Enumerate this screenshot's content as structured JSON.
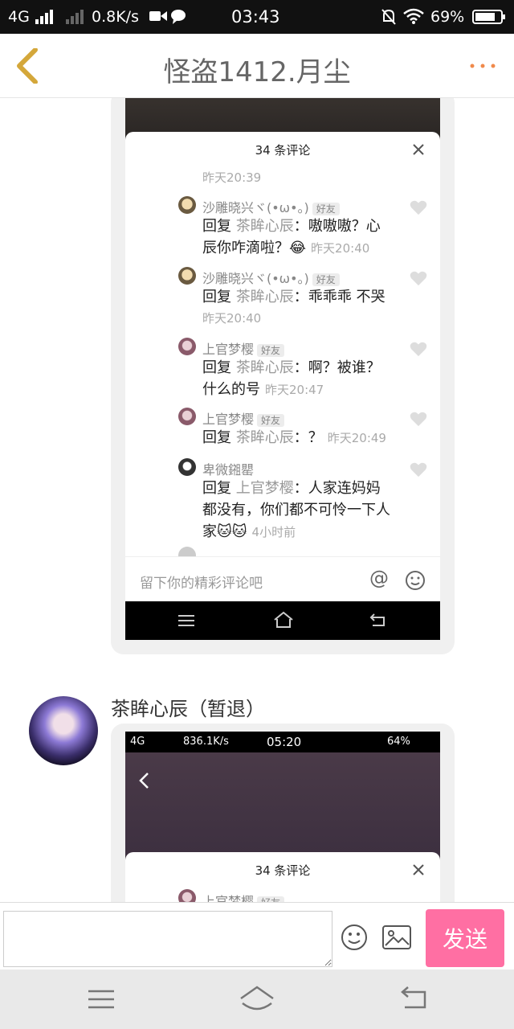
{
  "status_bar": {
    "network": "4G",
    "speed": "0.8K/s",
    "time": "03:43",
    "battery": "69%"
  },
  "header": {
    "back_icon": "chevron-left-icon",
    "title": "怪盗1412.月尘",
    "more_icon": "more-dots-icon"
  },
  "messages": [
    {
      "type": "image",
      "screenshot": {
        "panel_title": "34 条评论",
        "top_time": "昨天20:39",
        "comments": [
          {
            "name": "沙雕晓兴ヾ(•ω•。)",
            "badge": "好友",
            "reply_prefix": "回复",
            "reply_to": "茶眸心辰",
            "text_line1": "：嗷嗷嗷？心",
            "text_line2": "辰你咋滴啦？",
            "emoji": "😂",
            "time": "昨天20:40"
          },
          {
            "name": "沙雕晓兴ヾ(•ω•。)",
            "badge": "好友",
            "reply_prefix": "回复",
            "reply_to": "茶眸心辰",
            "text_line1": "：乖乖乖 不哭",
            "time": "昨天20:40"
          },
          {
            "name": "上官梦樱",
            "badge": "好友",
            "reply_prefix": "回复",
            "reply_to": "茶眸心辰",
            "text_line1": "：啊？被谁？",
            "text_line2": "什么的号",
            "time": "昨天20:47"
          },
          {
            "name": "上官梦樱",
            "badge": "好友",
            "reply_prefix": "回复",
            "reply_to": "茶眸心辰",
            "text_line1": "：？",
            "time": "昨天20:49"
          },
          {
            "name": "卑微鎺罌",
            "reply_prefix": "回复",
            "reply_to": "上官梦樱",
            "text_line1": "：人家连妈妈",
            "text_line2": "都没有，你们都不可怜一下人",
            "text_line3": "家",
            "emoji": "🐱🐱",
            "time": "4小时前"
          }
        ],
        "input_placeholder": "留下你的精彩评论吧"
      }
    },
    {
      "type": "image",
      "sender": "茶眸心辰（暂退）",
      "screenshot": {
        "status_network": "4G",
        "status_speed": "836.1K/s",
        "status_time": "05:20",
        "status_battery": "64%",
        "panel_title": "34 条评论",
        "first_name": "上官梦樱",
        "first_badge": "好友"
      }
    }
  ],
  "input_bar": {
    "value": "",
    "emoji_icon": "smiley-icon",
    "image_icon": "image-icon",
    "send_label": "发送"
  },
  "nav_bar": {
    "menu_icon": "menu-icon",
    "home_icon": "home-icon",
    "back_icon": "back-arrow-icon"
  },
  "colors": {
    "accent_pink": "#ff6fa3",
    "back_chevron": "#d4a73a",
    "more_dots": "#f08a4b"
  }
}
